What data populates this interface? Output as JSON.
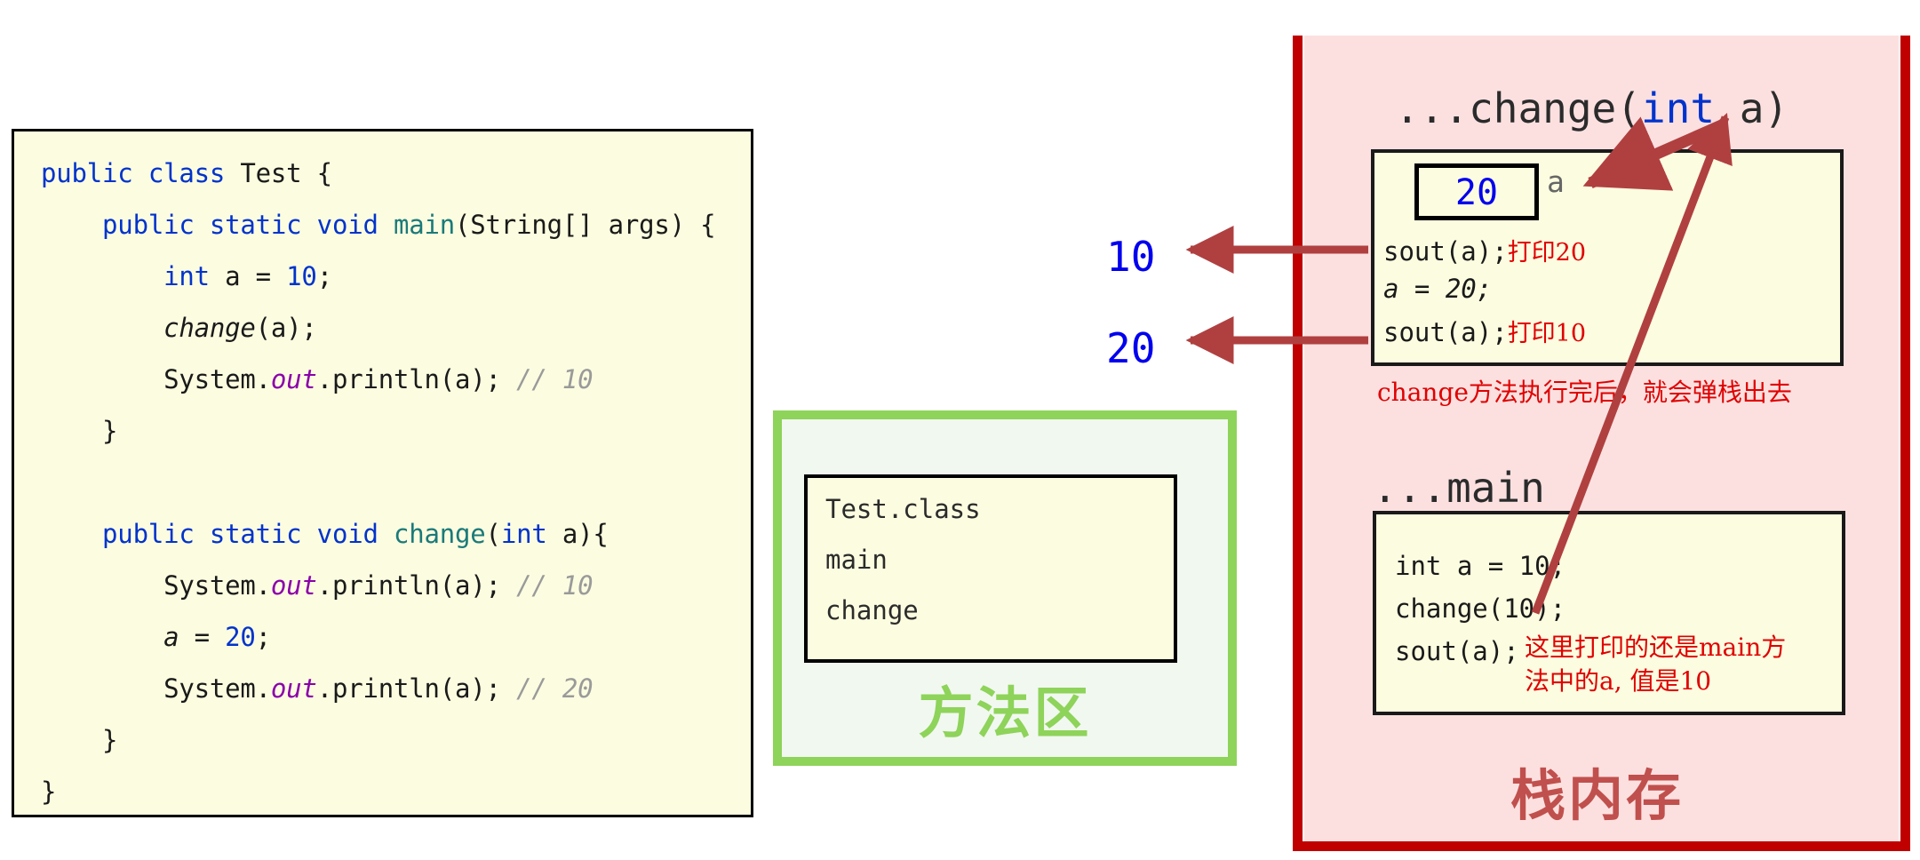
{
  "code_panel": {
    "lines": [
      [
        {
          "t": "public class ",
          "c": "kw"
        },
        {
          "t": "Test {",
          "c": ""
        }
      ],
      [
        {
          "t": "    ",
          "c": ""
        },
        {
          "t": "public static void ",
          "c": "kw"
        },
        {
          "t": "main",
          "c": "mth"
        },
        {
          "t": "(String[] args) {",
          "c": ""
        }
      ],
      [
        {
          "t": "        ",
          "c": ""
        },
        {
          "t": "int",
          "c": "kw"
        },
        {
          "t": " a = ",
          "c": ""
        },
        {
          "t": "10",
          "c": "num"
        },
        {
          "t": ";",
          "c": ""
        }
      ],
      [
        {
          "t": "        ",
          "c": ""
        },
        {
          "t": "change",
          "c": "ital"
        },
        {
          "t": "(a);",
          "c": ""
        }
      ],
      [
        {
          "t": "        System.",
          "c": ""
        },
        {
          "t": "out",
          "c": "fld"
        },
        {
          "t": ".println(a); ",
          "c": ""
        },
        {
          "t": "// 10",
          "c": "cmt"
        }
      ],
      [
        {
          "t": "    }",
          "c": ""
        }
      ],
      [
        {
          "t": " ",
          "c": ""
        }
      ],
      [
        {
          "t": "    ",
          "c": ""
        },
        {
          "t": "public static void ",
          "c": "kw"
        },
        {
          "t": "change",
          "c": "mth"
        },
        {
          "t": "(",
          "c": ""
        },
        {
          "t": "int",
          "c": "kw"
        },
        {
          "t": " a){",
          "c": ""
        }
      ],
      [
        {
          "t": "        System.",
          "c": ""
        },
        {
          "t": "out",
          "c": "fld"
        },
        {
          "t": ".println(a); ",
          "c": ""
        },
        {
          "t": "// 10",
          "c": "cmt"
        }
      ],
      [
        {
          "t": "        ",
          "c": ""
        },
        {
          "t": "a",
          "c": "ital"
        },
        {
          "t": " = ",
          "c": ""
        },
        {
          "t": "20",
          "c": "num"
        },
        {
          "t": ";",
          "c": ""
        }
      ],
      [
        {
          "t": "        System.",
          "c": ""
        },
        {
          "t": "out",
          "c": "fld"
        },
        {
          "t": ".println(a); ",
          "c": ""
        },
        {
          "t": "// 20",
          "c": "cmt"
        }
      ],
      [
        {
          "t": "    }",
          "c": ""
        }
      ],
      [
        {
          "t": "}",
          "c": ""
        }
      ]
    ]
  },
  "method_area": {
    "title": "方法区",
    "entries": [
      "Test.class",
      "main",
      "change"
    ],
    "border_color": "#8ed35a",
    "fill_color": "#f1f8f0",
    "inner_fill": "#fcfce0"
  },
  "stack": {
    "title": "栈内存",
    "title_color": "#c0504d",
    "border_color": "#c00000",
    "fill_color": "#fce0e0",
    "change_frame": {
      "title_prefix": "...change(",
      "title_kw": "int",
      "title_suffix": " a)",
      "variable_value": "20",
      "variable_label": "a",
      "lines": [
        {
          "code": "sout(a);",
          "note": "打印20"
        },
        {
          "code": "a = 20;",
          "note": ""
        },
        {
          "code": "sout(a);",
          "note": "打印10"
        }
      ],
      "pop_note": "change方法执行完后，就会弹栈出去"
    },
    "main_frame": {
      "title": "...main",
      "lines": [
        {
          "code": "int a = 10;"
        },
        {
          "code": "change(10);"
        },
        {
          "code": "sout(a);"
        }
      ],
      "note": "这里打印的还是main方法中的a, 值是10"
    }
  },
  "callouts": [
    {
      "value": "10",
      "color": "#0000ee"
    },
    {
      "value": "20",
      "color": "#0000ee"
    }
  ],
  "arrow_color": "#b04040",
  "chart_data": null
}
